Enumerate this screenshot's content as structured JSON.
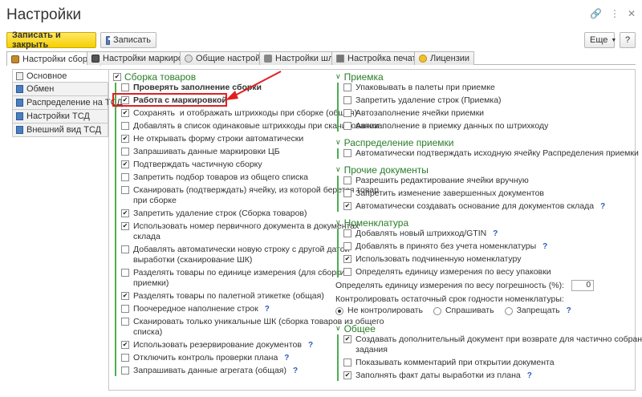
{
  "window": {
    "title": "Настройки"
  },
  "toolbar": {
    "save_close_label": "Записать и закрыть",
    "save_label": "Записать",
    "more_label": "Еще",
    "help_label": "?"
  },
  "tabs": [
    "Настройки сборки",
    "Настройки маркировки",
    "Общие настройки",
    "Настройки шлюз",
    "Настройка печати",
    "Лицензии"
  ],
  "sidebar": [
    "Основное",
    "Обмен",
    "Распределение на ТСД",
    "Настройки ТСД",
    "Внешний вид ТСД"
  ],
  "assembly": {
    "title": "Сборка товаров",
    "items": [
      {
        "label": "Проверять заполнение сборки",
        "checked": false,
        "bold": true
      },
      {
        "label": "Работа с маркировкой",
        "checked": true,
        "bold": true
      },
      {
        "label": "Сохранять  и отображать штрихкоды при сборке (общая)",
        "checked": true
      },
      {
        "label": "Добавлять в список одинаковые штрихкоды при сканировании",
        "checked": false
      },
      {
        "label": "Не открывать форму строки автоматически",
        "checked": true
      },
      {
        "label": "Запрашивать данные маркировки ЦБ",
        "checked": false
      },
      {
        "label": "Подтверждать частичную сборку",
        "checked": true
      },
      {
        "label": "Запретить подбор товаров из общего списка",
        "checked": false
      },
      {
        "label": "Сканировать (подтверждать) ячейку, из которой берется товар\nпри сборке",
        "checked": false
      },
      {
        "label": "Запретить удаление строк (Сборка товаров)",
        "checked": true
      },
      {
        "label": "Использовать номер первичного документа в документах\nсклада",
        "checked": true
      },
      {
        "label": "Добавлять автоматически новую строку с другой датой\nвыработки (сканирование ШК)",
        "checked": false
      },
      {
        "label": "Разделять товары по единице измерения (для сборки и\nприемки)",
        "checked": false
      },
      {
        "label": "Разделять товары по палетной этикетке (общая)",
        "checked": true
      },
      {
        "label": "Поочередное наполнение строк",
        "checked": false,
        "help": true
      },
      {
        "label": "Сканировать только уникальные ШК (сборка товаров из общего\nсписка)",
        "checked": false
      },
      {
        "label": "Использовать резервирование документов",
        "checked": true,
        "help": true
      },
      {
        "label": "Отключить контроль проверки плана",
        "checked": false,
        "help": true
      },
      {
        "label": "Запрашивать данные агрегата (общая)",
        "checked": false,
        "help": true
      }
    ]
  },
  "acceptance": {
    "title": "Приемка",
    "items": [
      {
        "label": "Упаковывать в палеты при приемке",
        "checked": false
      },
      {
        "label": "Запретить удаление строк (Приемка)",
        "checked": false
      },
      {
        "label": "Автозаполнение ячейки приемки",
        "checked": false
      },
      {
        "label": "Автозаполнение в приемку данных по штрихкоду",
        "checked": false
      }
    ]
  },
  "distribution": {
    "title": "Распределение приемки",
    "items": [
      {
        "label": "Автоматически подтверждать исходную ячейку Распределения приемки",
        "checked": false
      }
    ]
  },
  "other_docs": {
    "title": "Прочие документы",
    "items": [
      {
        "label": "Разрешить редактирование ячейки вручную",
        "checked": false
      },
      {
        "label": "Запретить изменение завершенных документов",
        "checked": false
      },
      {
        "label": "Автоматически создавать основание для документов склада",
        "checked": true,
        "help": true
      }
    ]
  },
  "nomenclature": {
    "title": "Номенклатура",
    "items": [
      {
        "label": "Добавлять новый штрихкод/GTIN",
        "checked": false,
        "help": true
      },
      {
        "label": "Добавлять в принято без учета номенклатуры",
        "checked": false,
        "help": true
      },
      {
        "label": "Использовать подчиненную номенклатуру",
        "checked": true
      },
      {
        "label": "Определять единицу измерения по весу упаковки",
        "checked": false
      }
    ],
    "weight_label": "Определять единицу измерения по весу погрешность (%):",
    "weight_value": "0",
    "shelf_label": "Контролировать остаточный срок годности номенклатуры:",
    "shelf_options": [
      "Не контролировать",
      "Спрашивать",
      "Запрещать"
    ],
    "help": "?"
  },
  "general": {
    "title": "Общее",
    "items": [
      {
        "label": "Создавать дополнительный документ при возврате для частично собранного\nзадания",
        "checked": true,
        "help": true
      },
      {
        "label": "Показывать комментарий при открытии документа",
        "checked": false
      },
      {
        "label": "Заполнять факт даты выработки из плана",
        "checked": true,
        "help": true
      }
    ]
  },
  "help_mark": "?"
}
